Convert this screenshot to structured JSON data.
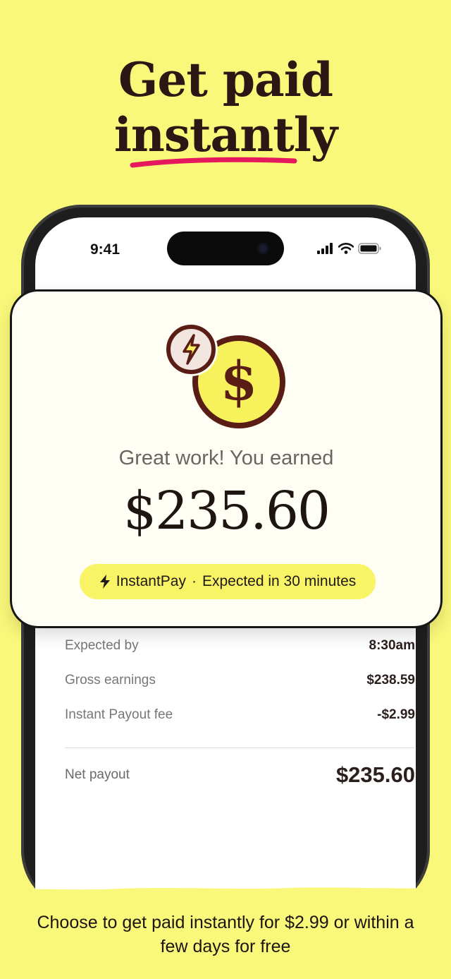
{
  "headline": {
    "line1": "Get paid",
    "line2": "instantly"
  },
  "status_bar": {
    "time": "9:41"
  },
  "card": {
    "subtitle": "Great work! You earned",
    "amount": "$235.60",
    "pill": {
      "label": "InstantPay",
      "separator": "·",
      "detail": "Expected in 30 minutes"
    }
  },
  "details": {
    "rows": [
      {
        "label": "Expected by",
        "value": "8:30am"
      },
      {
        "label": "Gross earnings",
        "value": "$238.59"
      },
      {
        "label": "Instant Payout fee",
        "value": "-$2.99"
      }
    ],
    "net": {
      "label": "Net payout",
      "value": "$235.60"
    }
  },
  "footer": {
    "caption": "Choose to get paid instantly for $2.99 or within a few days for free"
  },
  "colors": {
    "background": "#faf87a",
    "accent_underline": "#e5185e",
    "pill": "#f9f366",
    "coin": "#f7f25c",
    "ink": "#2d1714"
  },
  "icons": [
    "lightning-badge-icon",
    "dollar-coin-icon",
    "cellular-signal-icon",
    "wifi-icon",
    "battery-icon",
    "bolt-icon"
  ]
}
